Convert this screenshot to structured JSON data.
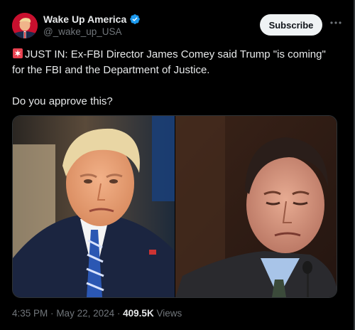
{
  "post": {
    "author": {
      "display_name": "Wake Up America",
      "handle": "@_wake_up_USA",
      "verified_icon": "verified-badge-icon",
      "avatar_icon": "profile-avatar"
    },
    "subscribe_label": "Subscribe",
    "more_icon": "more-options-icon",
    "text_line1": "JUST IN: Ex-FBI Director James Comey said Trump \"is coming\" for the FBI and the Department of Justice.",
    "text_question": "Do you approve this?",
    "emoji": "siren-emoji",
    "media": {
      "left_photo": "photo-of-donald-trump",
      "right_photo": "photo-of-james-comey"
    },
    "meta": {
      "time": "4:35 PM",
      "sep1": "·",
      "date": "May 22, 2024",
      "sep2": "·",
      "views_count": "409.5K",
      "views_label": "Views"
    }
  },
  "colors": {
    "background": "#000000",
    "text": "#e7e9ea",
    "muted": "#71767b",
    "verified": "#1d9bf0",
    "subscribe_bg": "#eff3f4"
  }
}
